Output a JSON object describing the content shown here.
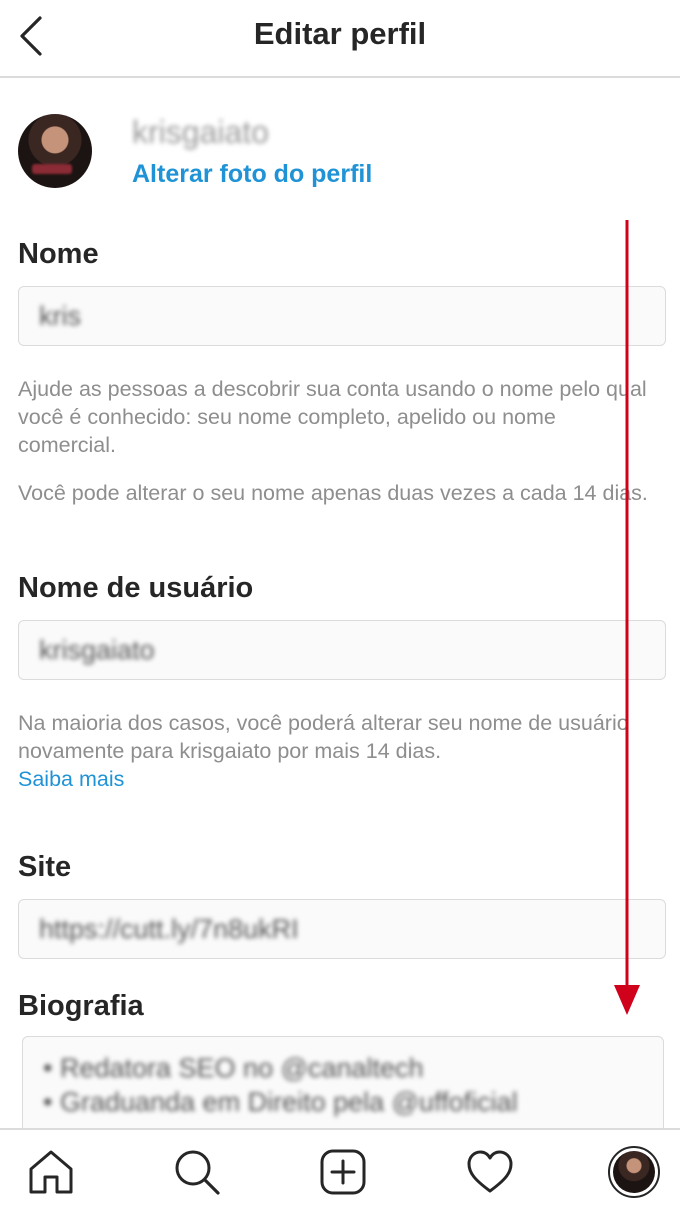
{
  "header": {
    "title": "Editar perfil",
    "back_icon": "chevron-left-icon"
  },
  "profile": {
    "username": "krisgaiato",
    "change_photo_label": "Alterar foto do perfil"
  },
  "fields": {
    "name": {
      "label": "Nome",
      "value": "kris",
      "help_1": "Ajude as pessoas a descobrir sua conta usando o nome pelo qual você é conhecido: seu nome completo, apelido ou nome comercial.",
      "help_2": "Você pode alterar o seu nome apenas duas vezes a cada 14 dias."
    },
    "username": {
      "label": "Nome de usuário",
      "value": "krisgaiato",
      "help": "Na maioria dos casos, você poderá alterar seu nome de usuário novamente para krisgaiato por mais 14 dias.",
      "link": "Saiba mais"
    },
    "site": {
      "label": "Site",
      "value": "https://cutt.ly/7n8ukRI"
    },
    "bio": {
      "label": "Biografia",
      "line_1": "• Redatora SEO no @canaltech",
      "line_2": "• Graduanda em Direito pela @uffoficial"
    }
  },
  "bottom_nav": {
    "items": [
      {
        "icon": "home-icon"
      },
      {
        "icon": "search-icon"
      },
      {
        "icon": "new-post-icon"
      },
      {
        "icon": "heart-icon"
      },
      {
        "icon": "profile-avatar"
      }
    ]
  },
  "colors": {
    "accent_link": "#1f93d6",
    "arrow": "#d0021b",
    "border": "#dbdbdb",
    "help_text": "#8e8e8e"
  }
}
